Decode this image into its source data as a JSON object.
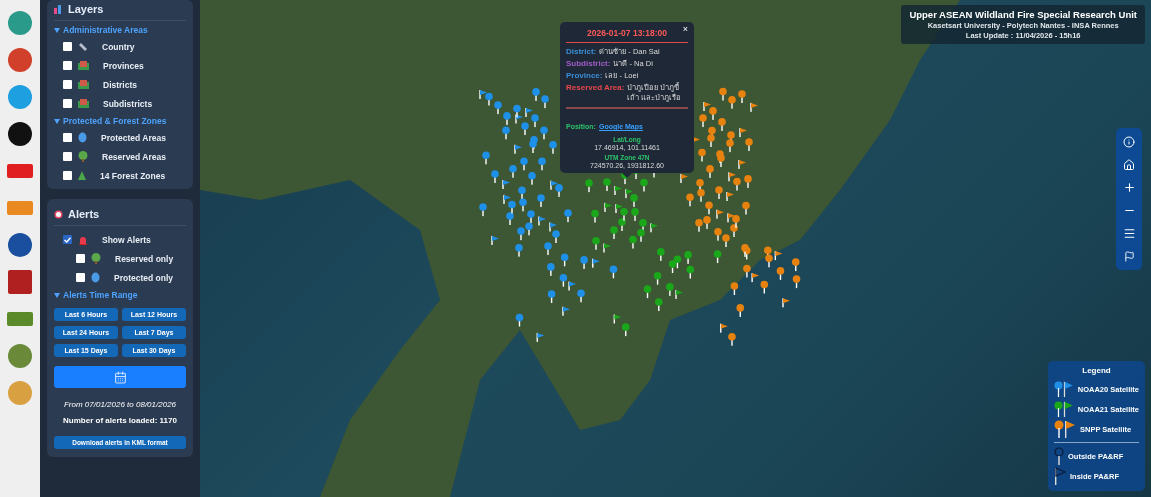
{
  "layers": {
    "title": "Layers",
    "groups": [
      {
        "title": "Administrative Areas",
        "items": [
          {
            "label": "Country",
            "checked": false,
            "kind": "line"
          },
          {
            "label": "Provinces",
            "checked": false,
            "kind": "area"
          },
          {
            "label": "Districts",
            "checked": false,
            "kind": "area"
          },
          {
            "label": "Subdistricts",
            "checked": false,
            "kind": "area"
          }
        ]
      },
      {
        "title": "Protected & Forest Zones",
        "items": [
          {
            "label": "Protected Areas",
            "checked": false,
            "kind": "shield"
          },
          {
            "label": "Reserved Areas",
            "checked": false,
            "kind": "tree"
          },
          {
            "label": "14 Forest Zones",
            "checked": false,
            "kind": "pine"
          }
        ]
      }
    ]
  },
  "alerts": {
    "title": "Alerts",
    "options": [
      {
        "label": "Show Alerts",
        "checked": true,
        "kind": "siren",
        "nested": false
      },
      {
        "label": "Reserved only",
        "checked": false,
        "kind": "tree",
        "nested": true
      },
      {
        "label": "Protected only",
        "checked": false,
        "kind": "shield",
        "nested": true
      }
    ],
    "time_range_title": "Alerts Time Range",
    "time_buttons": [
      "Last 6 Hours",
      "Last 12 Hours",
      "Last 24 Hours",
      "Last 7 Days",
      "Last 15 Days",
      "Last 30 Days"
    ],
    "range_text": "From 07/01/2026 to 08/01/2026",
    "count_text": "Number of alerts loaded: 1170",
    "download_button": "Download alerts in KML format"
  },
  "header": {
    "title": "Upper ASEAN Wildland Fire Special Research Unit",
    "subtitle": "Kasetsart University - Polytech Nantes - INSA Rennes",
    "update": "Last Update : 11/04/2026 - 15h16"
  },
  "popup": {
    "close": "×",
    "datetime": "2026-01-07 13:18:00",
    "fields": [
      {
        "label": "District:",
        "value": "ด่านซ้าย - Dan Sai",
        "color": "#3a8fd8"
      },
      {
        "label": "Subdistrict:",
        "value": "นาดี - Na Di",
        "color": "#a05cc8"
      },
      {
        "label": "Province:",
        "value": "เลย - Loei",
        "color": "#3a8fd8"
      },
      {
        "label": "Reserved Area:",
        "value": "ป่าภูเปือย ป่าภูขี้เถ้า และป่าภูเรือ",
        "color": "#e8474c"
      }
    ],
    "position_label": "Position:",
    "position_link": "Google Maps",
    "latlong_label": "Lat/Long",
    "latlong": "17.46914, 101.11461",
    "utm_label": "UTM Zone 47N",
    "utm": "724570.26, 1931812.60"
  },
  "legend": {
    "title": "Legend",
    "items": [
      {
        "label": "NOAA20 Satellite",
        "kind": "satellite",
        "color": "#1e90e8"
      },
      {
        "label": "NOAA21 Satellite",
        "kind": "satellite",
        "color": "#1aa81a"
      },
      {
        "label": "SNPP Satellite",
        "kind": "satellite",
        "color": "#e8820e"
      },
      {
        "label": "Outside PA&RF",
        "kind": "outside"
      },
      {
        "label": "Inside PA&RF",
        "kind": "inside"
      }
    ]
  }
}
